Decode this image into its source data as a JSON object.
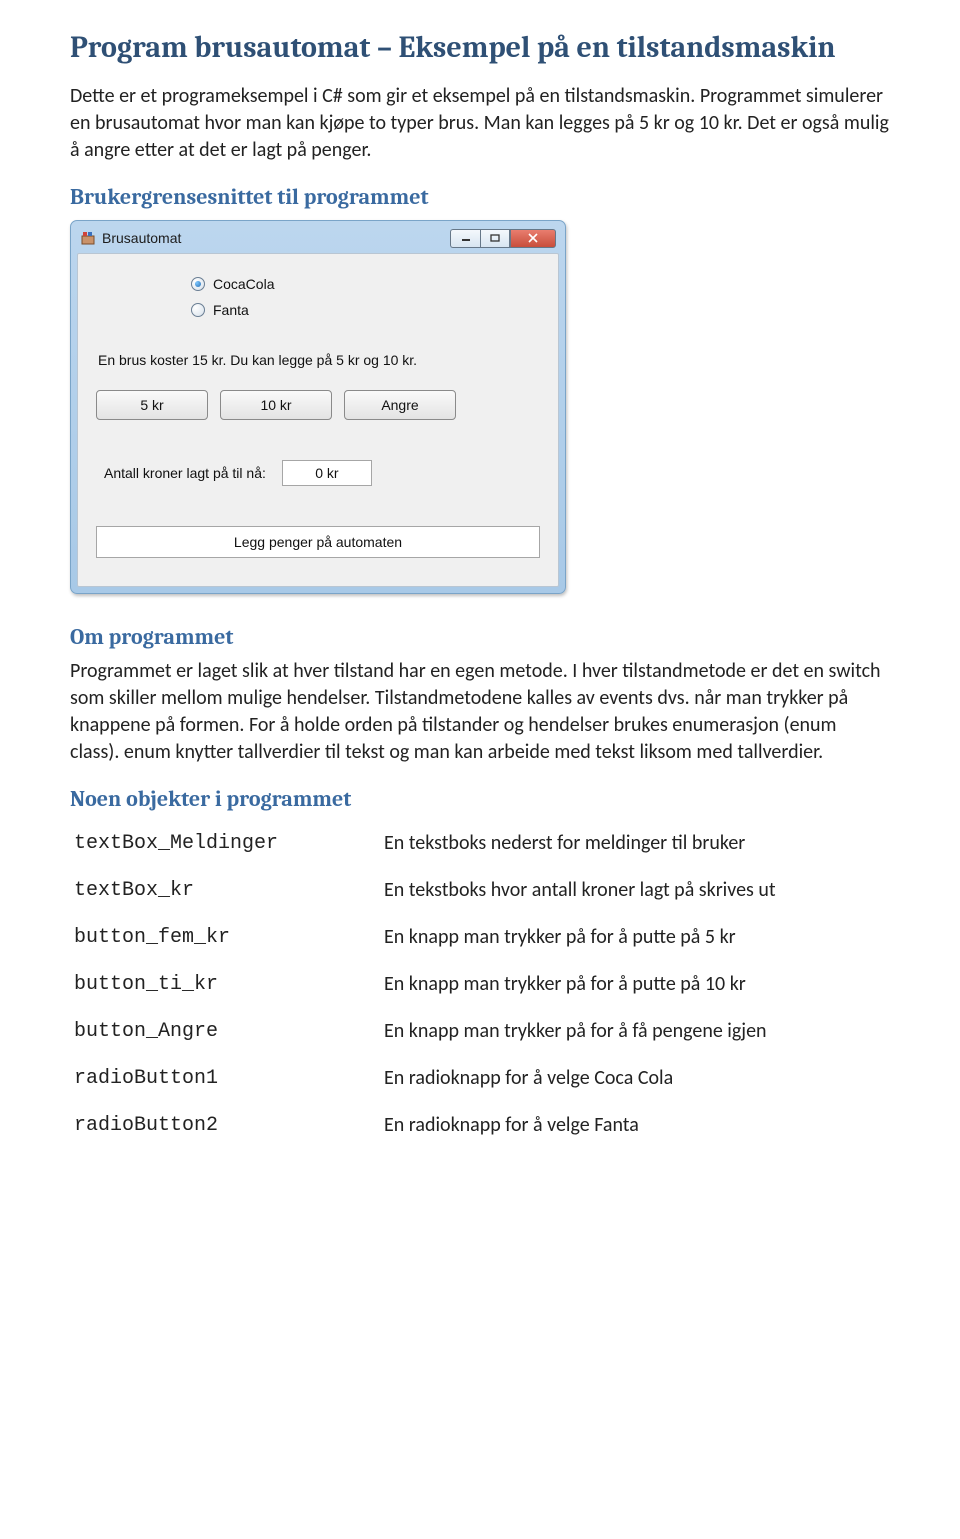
{
  "doc": {
    "title": "Program brusautomat – Eksempel på en tilstandsmaskin",
    "intro": "Dette er et programeksempel i C# som gir et eksempel på en tilstandsmaskin. Programmet simulerer en brusautomat hvor man kan kjøpe to typer brus. Man kan legges på 5 kr og 10 kr. Det er også mulig å angre etter at det er lagt på penger.",
    "section_gui": "Brukergrensesnittet til programmet",
    "section_about": "Om programmet",
    "about_text": "Programmet er laget slik at hver tilstand har en egen metode. I hver tilstandmetode er det en switch som skiller mellom mulige hendelser. Tilstandmetodene kalles av events dvs. når man trykker på knappene på formen. For å holde orden på tilstander og hendelser brukes enumerasjon (enum class). enum knytter tallverdier til tekst og man kan arbeide med tekst liksom med tallverdier.",
    "section_objects": "Noen objekter i programmet",
    "objects": [
      {
        "name": "textBox_Meldinger",
        "desc": "En tekstboks nederst for meldinger til bruker"
      },
      {
        "name": "textBox_kr",
        "desc": "En tekstboks hvor antall kroner lagt på skrives ut"
      },
      {
        "name": "button_fem_kr",
        "desc": "En knapp man trykker på for å putte på 5 kr"
      },
      {
        "name": "button_ti_kr",
        "desc": "En knapp man trykker på for å putte på 10 kr"
      },
      {
        "name": "button_Angre",
        "desc": "En knapp man trykker på for å få pengene igjen"
      },
      {
        "name": "radioButton1",
        "desc": "En radioknapp for å velge Coca Cola"
      },
      {
        "name": "radioButton2",
        "desc": "En radioknapp for å velge Fanta"
      }
    ]
  },
  "app": {
    "window_title": "Brusautomat",
    "radios": {
      "cocacola": "CocaCola",
      "fanta": "Fanta"
    },
    "price_line": "En brus koster 15 kr. Du kan legge på 5 kr og 10 kr.",
    "buttons": {
      "five": "5 kr",
      "ten": "10 kr",
      "undo": "Angre"
    },
    "amount_label": "Antall kroner lagt på til nå:",
    "amount_value": "0 kr",
    "message": "Legg penger på automaten"
  }
}
